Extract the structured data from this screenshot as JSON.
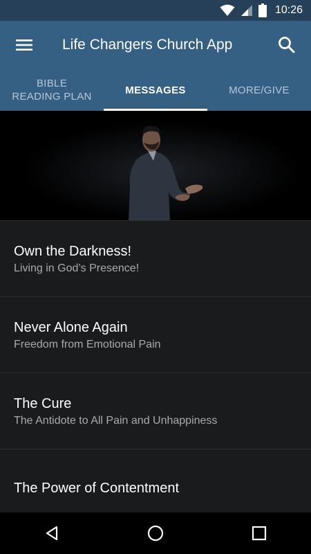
{
  "status_bar": {
    "time": "10:26",
    "icons": [
      "wifi-icon",
      "signal-icon",
      "battery-icon"
    ]
  },
  "app_bar": {
    "title": "Life Changers Church App",
    "menu_icon": "hamburger-menu-icon",
    "search_icon": "search-icon"
  },
  "tabs": [
    {
      "label": "BIBLE\nREADING PLAN",
      "active": false
    },
    {
      "label": "MESSAGES",
      "active": true
    },
    {
      "label": "MORE/GIVE",
      "active": false
    }
  ],
  "hero": {
    "image": "speaker-on-stage"
  },
  "messages": [
    {
      "title": "Own the Darkness!",
      "subtitle": "Living in God’s Presence!"
    },
    {
      "title": "Never Alone Again",
      "subtitle": "Freedom from Emotional Pain"
    },
    {
      "title": "The Cure",
      "subtitle": "The Antidote to All Pain and Unhappiness"
    },
    {
      "title": "The Power of Contentment",
      "subtitle": ""
    }
  ],
  "nav_bar": {
    "icons": [
      "back-icon",
      "home-icon",
      "recents-icon"
    ]
  },
  "colors": {
    "primary": "#365f84",
    "status_bar": "#27405a",
    "background": "#1a1b1d",
    "divider": "#2c2d31",
    "subtitle": "#a9abaf"
  }
}
